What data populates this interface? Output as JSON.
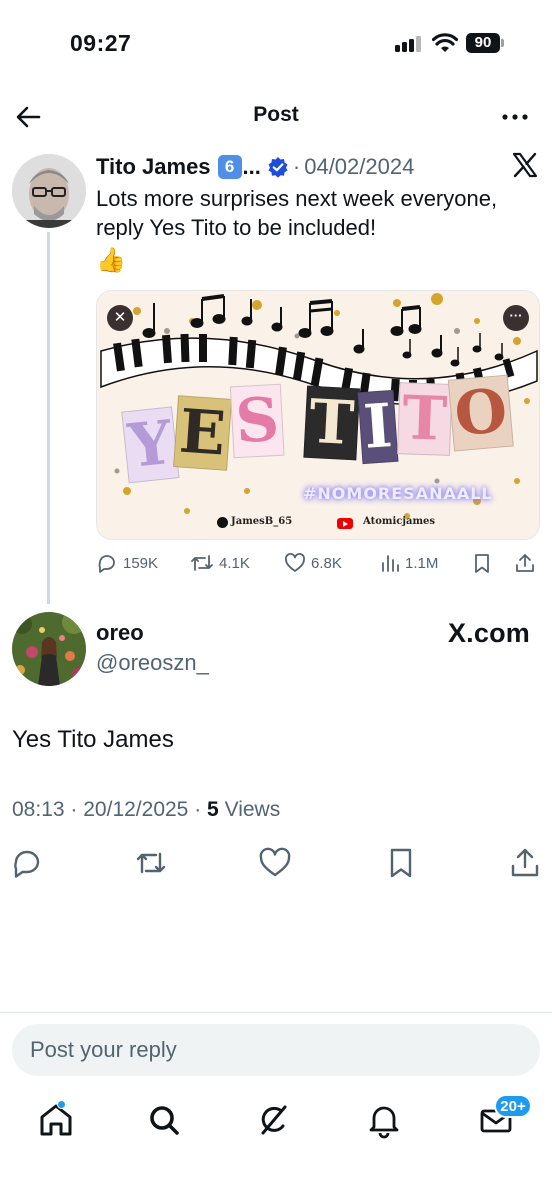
{
  "status_bar": {
    "time": "09:27",
    "battery": "90"
  },
  "header": {
    "title": "Post"
  },
  "parent_post": {
    "author_name": "Tito James",
    "author_emoji": "6",
    "truncation": "...",
    "separator": "·",
    "date": "04/02/2024",
    "text": "Lots more surprises next week everyone, reply Yes Tito to be included!",
    "emoji": "👍",
    "media": {
      "title_letters": [
        "Y",
        "E",
        "S",
        "T",
        "I",
        "T",
        "O"
      ],
      "hashtag": "#NOMORESANAALL",
      "tag_x": "JamesB_65",
      "tag_youtube": "Atomicjames",
      "close_glyph": "✕",
      "more_glyph": "···"
    },
    "actions": {
      "replies": "159K",
      "reposts": "4.1K",
      "likes": "6.8K",
      "views": "1.1M"
    }
  },
  "reply_post": {
    "name": "oreo",
    "handle": "@oreoszn_",
    "watermark": "X.com",
    "text": "Yes Tito James",
    "time": "08:13",
    "date_sep": "·",
    "date": "20/12/2025",
    "views_sep": "·",
    "views_count": "5",
    "views_label": "Views"
  },
  "composer": {
    "placeholder": "Post your reply"
  },
  "tabbar": {
    "messages_badge": "20+"
  },
  "colors": {
    "accent": "#1d9bf0",
    "muted": "#536471",
    "verified": "#1d4ed8"
  },
  "icons": [
    "back-arrow-icon",
    "more-icon",
    "verified-icon",
    "x-logo-icon",
    "reply-icon",
    "repost-icon",
    "like-icon",
    "views-icon",
    "bookmark-icon",
    "share-icon",
    "home-icon",
    "search-icon",
    "grok-icon",
    "bell-icon",
    "mail-icon"
  ]
}
